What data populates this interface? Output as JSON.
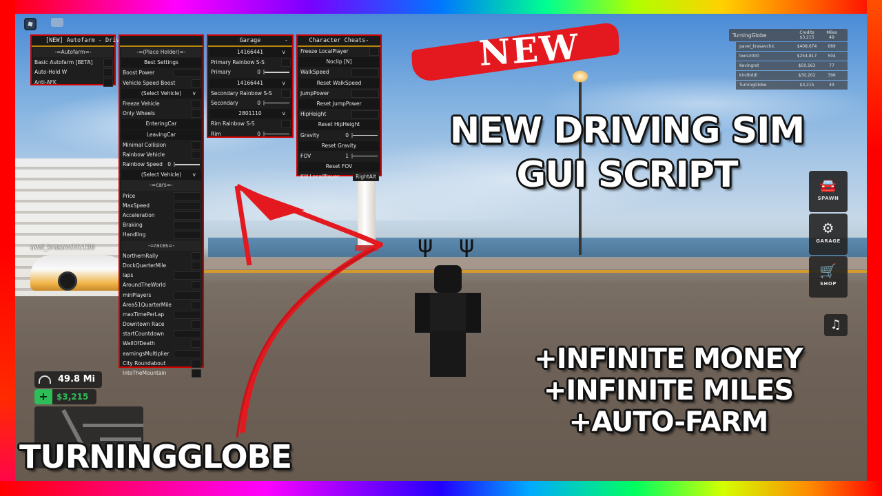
{
  "thumbnail": {
    "badge": "NEW",
    "headline": [
      "NEW DRIVING SIM",
      "GUI SCRIPT"
    ],
    "features": [
      "+INFINITE MONEY",
      "+INFINITE MILES",
      "+AUTO-FARM"
    ],
    "brand": "TURNINGGLOBE"
  },
  "gui": {
    "autofarm": {
      "title": "[NEW] Autofarm - Driving Simulator [Beta]",
      "section": "-=Autofarm=-",
      "toggles": [
        "Basic Autofarm [BETA]",
        "Auto-Hold W",
        "Anti-AFK"
      ]
    },
    "driving": {
      "section_placeholder": "-=(Place Holder)=-",
      "best_settings": "Best Settings",
      "boost_power": "Boost Power",
      "vehicle_speed_boost": "Vehicle Speed Boost",
      "select_vehicle_1": "(Select Vehicle)",
      "freeze_vehicle": "Freeze Vehicle",
      "only_wheels": "Only Wheels",
      "entering_car": "EnteringCar",
      "leaving_car": "LeavingCar",
      "minimal_collision": "Minimal Collision",
      "rainbow_vehicle": "Rainbow Vehicle",
      "rainbow_speed": "Rainbow Speed",
      "rainbow_speed_value": "0",
      "select_vehicle_2": "(Select Vehicle)",
      "dropdown_arrow": "v",
      "cars_section": "-=cars=-",
      "car_fields": [
        "Price",
        "MaxSpeed",
        "Acceleration",
        "Braking",
        "Handling"
      ],
      "races_section": "-=races=-",
      "races": [
        {
          "label": "NorthernRally",
          "type": "toggle"
        },
        {
          "label": "DockQuarterMile",
          "type": "toggle"
        },
        {
          "label": "laps",
          "type": "input"
        },
        {
          "label": "AroundTheWorld",
          "type": "toggle"
        },
        {
          "label": "minPlayers",
          "type": "input"
        },
        {
          "label": "Area51QuarterMile",
          "type": "toggle"
        },
        {
          "label": "maxTimePerLap",
          "type": "input"
        },
        {
          "label": "Downtown Race",
          "type": "toggle"
        },
        {
          "label": "startCountdown",
          "type": "input"
        },
        {
          "label": "WallOfDeath",
          "type": "toggle"
        },
        {
          "label": "earningsMultiplier",
          "type": "input"
        },
        {
          "label": "City Roundabout",
          "type": "toggle"
        },
        {
          "label": "IntoTheMountain",
          "type": "toggle"
        }
      ]
    },
    "garage": {
      "title": "Garage",
      "minimize": "-",
      "primary_color": "14166441",
      "primary_rainbow": "Primary Rainbow S-S",
      "primary_label": "Primary",
      "primary_value": "0",
      "secondary_color": "14166441",
      "secondary_rainbow": "Secondary Rainbow S-S",
      "secondary_label": "Secondary",
      "secondary_value": "0",
      "rim_color": "2801110",
      "rim_rainbow": "Rim Rainbow S-S",
      "rim_label": "Rim",
      "rim_value": "0",
      "dropdown_arrow": "v"
    },
    "character": {
      "title": "Character Cheats",
      "minimize": "-",
      "freeze_local_player": "Freeze LocalPlayer",
      "noclip": "Noclip [N]",
      "walkspeed": "WalkSpeed",
      "reset_walkspeed": "Reset WalkSpeed",
      "jumppower": "JumpPower",
      "reset_jumppower": "Reset JumpPower",
      "hipheight": "HipHeight",
      "reset_hipheight": "Reset HipHeight",
      "gravity": "Gravity",
      "gravity_value": "0",
      "reset_gravity": "Reset Gravity",
      "fov": "FOV",
      "fov_value": "1",
      "reset_fov": "Reset FOV",
      "kill_local_player": "Kill LocalPlayer",
      "kill_keybind": "RightAlt"
    }
  },
  "leaderboard": {
    "player": "TurningGlobe",
    "credits_header": "Credits",
    "miles_header": "Miles",
    "player_credits": "$3,215",
    "player_miles": "49",
    "rows": [
      {
        "name": "pavel_krasavchic",
        "credits": "$408,674",
        "miles": "689"
      },
      {
        "name": "loxis3000",
        "credits": "$254,817",
        "miles": "504"
      },
      {
        "name": "Kevingrot",
        "credits": "$50,163",
        "miles": "77"
      },
      {
        "name": "kindtiddl",
        "credits": "$30,202",
        "miles": "396"
      },
      {
        "name": "TurningGlobe",
        "credits": "$3,215",
        "miles": "49"
      }
    ]
  },
  "side_menu": {
    "spawn": "SPAWN",
    "garage": "GARAGE",
    "shop": "SHOP"
  },
  "hud": {
    "miles": "49.8 Mi",
    "money": "$3,215",
    "nametag": "avel_krasavchic130"
  },
  "colors": {
    "gui_border": "#d00000",
    "gui_title_underline": "#b8860b",
    "money_green": "#2ebd59",
    "banner_red": "#e3191f"
  }
}
